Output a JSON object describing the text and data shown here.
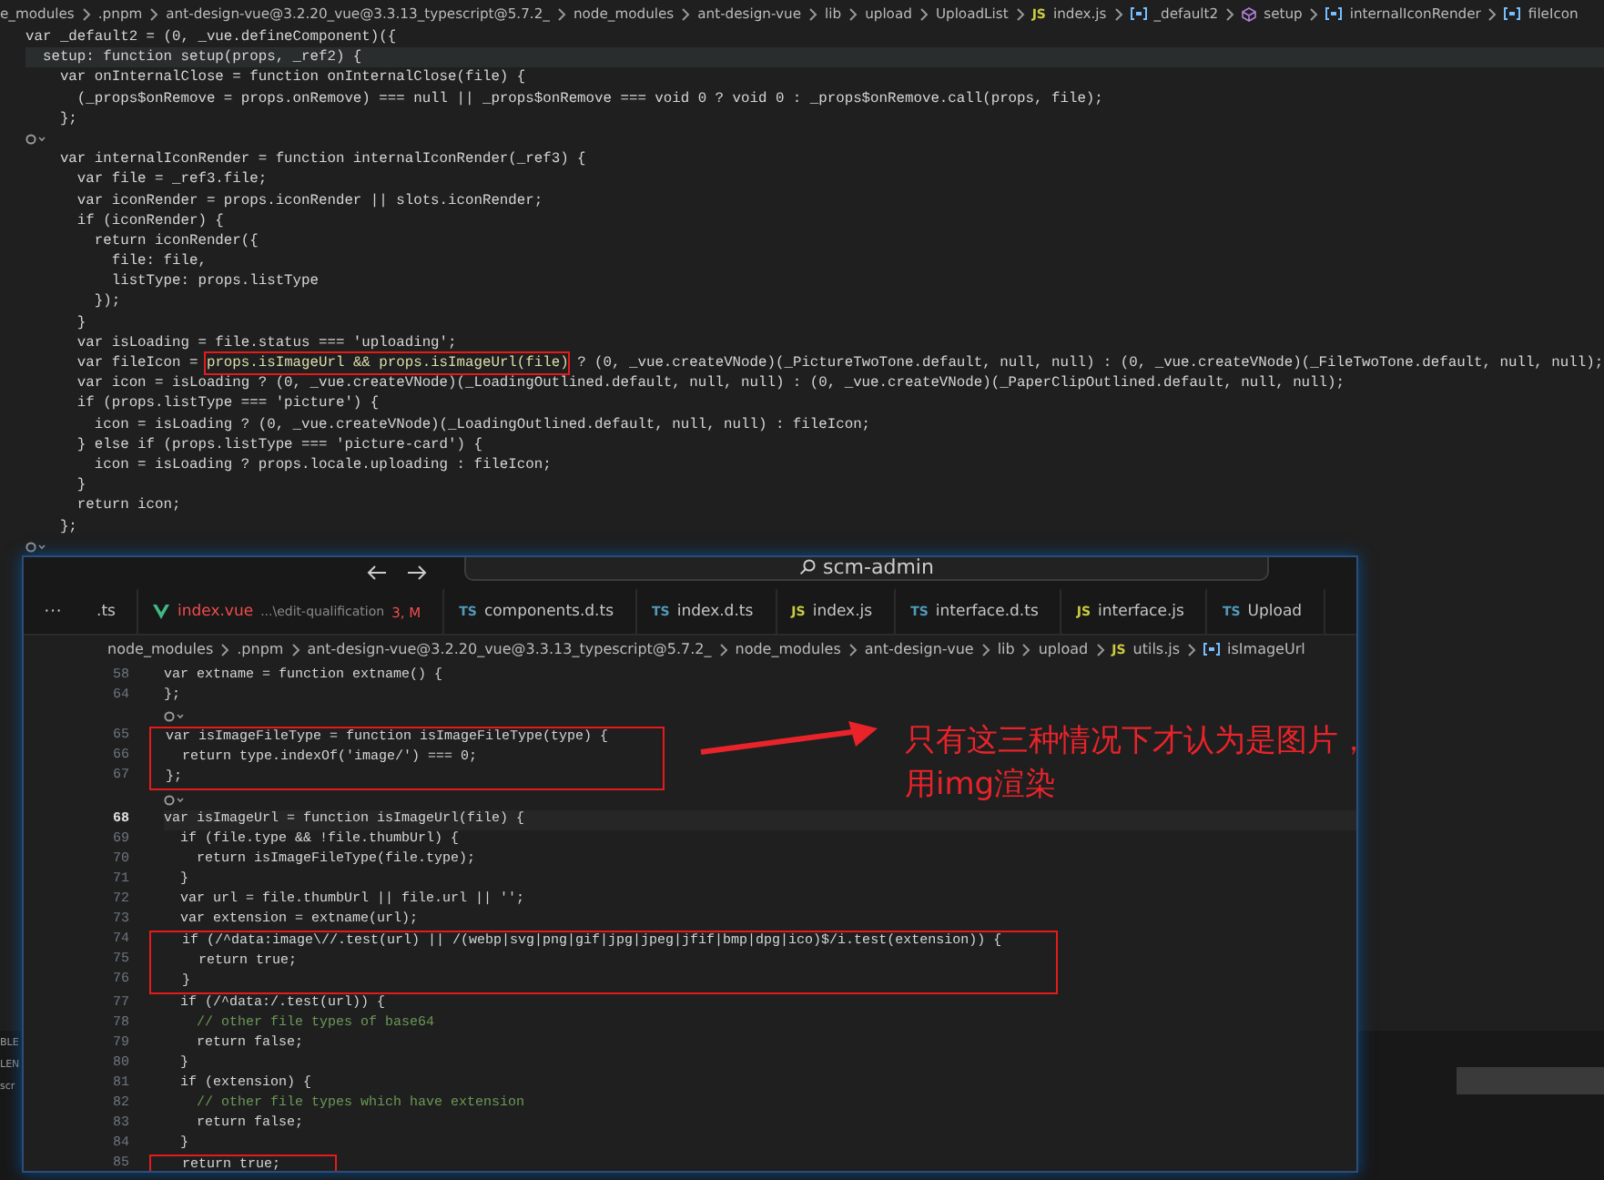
{
  "back_editor": {
    "breadcrumbs": [
      {
        "text": "e_modules",
        "kind": "folder"
      },
      {
        "text": ".pnpm",
        "kind": "folder"
      },
      {
        "text": "ant-design-vue@3.2.20_vue@3.3.13_typescript@5.7.2_",
        "kind": "folder"
      },
      {
        "text": "node_modules",
        "kind": "folder"
      },
      {
        "text": "ant-design-vue",
        "kind": "folder"
      },
      {
        "text": "lib",
        "kind": "folder"
      },
      {
        "text": "upload",
        "kind": "folder"
      },
      {
        "text": "UploadList",
        "kind": "folder"
      },
      {
        "text": "index.js",
        "kind": "js",
        "type_label": "JS"
      },
      {
        "text": "_default2",
        "kind": "variable"
      },
      {
        "text": "setup",
        "kind": "method"
      },
      {
        "text": "internalIconRender",
        "kind": "variable"
      },
      {
        "text": "fileIcon",
        "kind": "variable"
      }
    ],
    "lines": [
      {
        "kind": "code",
        "text": "var _default2 = (0, _vue.defineComponent)({",
        "current": false
      },
      {
        "kind": "code",
        "text": "  setup: function setup(props, _ref2) {",
        "current": true
      },
      {
        "kind": "code",
        "text": "    var onInternalClose = function onInternalClose(file) {",
        "current": false
      },
      {
        "kind": "code",
        "text": "      (_props$onRemove = props.onRemove) === null || _props$onRemove === void 0 ? void 0 : _props$onRemove.call(props, file);",
        "current": false
      },
      {
        "kind": "code",
        "text": "    };",
        "current": false
      },
      {
        "kind": "fold"
      },
      {
        "kind": "code",
        "text": "    var internalIconRender = function internalIconRender(_ref3) {",
        "current": false
      },
      {
        "kind": "code",
        "text": "      var file = _ref3.file;",
        "current": false
      },
      {
        "kind": "code",
        "text": "      var iconRender = props.iconRender || slots.iconRender;",
        "current": false
      },
      {
        "kind": "code",
        "text": "      if (iconRender) {",
        "current": false
      },
      {
        "kind": "code",
        "text": "        return iconRender({",
        "current": false
      },
      {
        "kind": "code",
        "text": "          file: file,",
        "current": false
      },
      {
        "kind": "code",
        "text": "          listType: props.listType",
        "current": false
      },
      {
        "kind": "code",
        "text": "        });",
        "current": false
      },
      {
        "kind": "code",
        "text": "      }",
        "current": false
      },
      {
        "kind": "code",
        "text": "      var isLoading = file.status === 'uploading';",
        "current": false
      },
      {
        "kind": "boxed",
        "text": "      var fileIcon = ",
        "boxed": "props.isImageUrl && props.isImageUrl(file)",
        "rest": " ? (0, _vue.createVNode)(_PictureTwoTone.default, null, null) : (0, _vue.createVNode)(_FileTwoTone.default, null, null);",
        "current": false
      },
      {
        "kind": "code",
        "text": "      var icon = isLoading ? (0, _vue.createVNode)(_LoadingOutlined.default, null, null) : (0, _vue.createVNode)(_PaperClipOutlined.default, null, null);",
        "current": false
      },
      {
        "kind": "code",
        "text": "      if (props.listType === 'picture') {",
        "current": false
      },
      {
        "kind": "code",
        "text": "        icon = isLoading ? (0, _vue.createVNode)(_LoadingOutlined.default, null, null) : fileIcon;",
        "current": false
      },
      {
        "kind": "code",
        "text": "      } else if (props.listType === 'picture-card') {",
        "current": false
      },
      {
        "kind": "code",
        "text": "        icon = isLoading ? props.locale.uploading : fileIcon;",
        "current": false
      },
      {
        "kind": "code",
        "text": "      }",
        "current": false
      },
      {
        "kind": "code",
        "text": "      return icon;",
        "current": false
      },
      {
        "kind": "code",
        "text": "    };",
        "current": false
      },
      {
        "kind": "fold"
      }
    ],
    "side_fragments": [
      "BLE",
      "LEN",
      "scr"
    ]
  },
  "front_window": {
    "search": {
      "value": "scm-admin"
    },
    "tabs": [
      {
        "kind": "plain",
        "label": ".ts",
        "selected": false,
        "has_errors": false
      },
      {
        "kind": "vue",
        "label": "index.vue",
        "detail": "...\\edit-qualification",
        "badge": "3, M",
        "selected": false,
        "has_errors": true
      },
      {
        "kind": "ts",
        "type_label": "TS",
        "label": "components.d.ts",
        "selected": false,
        "has_errors": false
      },
      {
        "kind": "ts",
        "type_label": "TS",
        "label": "index.d.ts",
        "selected": false,
        "has_errors": false
      },
      {
        "kind": "js",
        "type_label": "JS",
        "label": "index.js",
        "selected": false,
        "has_errors": false
      },
      {
        "kind": "ts",
        "type_label": "TS",
        "label": "interface.d.ts",
        "selected": false,
        "has_errors": false
      },
      {
        "kind": "js",
        "type_label": "JS",
        "label": "interface.js",
        "selected": false,
        "has_errors": false
      },
      {
        "kind": "ts",
        "type_label": "TS",
        "label": "Upload",
        "selected": false,
        "has_errors": false
      }
    ],
    "overflow_label": "···",
    "breadcrumbs": [
      {
        "text": "node_modules",
        "kind": "folder"
      },
      {
        "text": ".pnpm",
        "kind": "folder"
      },
      {
        "text": "ant-design-vue@3.2.20_vue@3.3.13_typescript@5.7.2_",
        "kind": "folder"
      },
      {
        "text": "node_modules",
        "kind": "folder"
      },
      {
        "text": "ant-design-vue",
        "kind": "folder"
      },
      {
        "text": "lib",
        "kind": "folder"
      },
      {
        "text": "upload",
        "kind": "folder"
      },
      {
        "text": "utils.js",
        "kind": "js",
        "type_label": "JS"
      },
      {
        "text": "isImageUrl",
        "kind": "variable"
      }
    ],
    "blocks": [
      {
        "framed": false,
        "lines": [
          {
            "kind": "code",
            "number": "58",
            "text": "var extname = function extname() {",
            "current": false
          },
          {
            "kind": "code",
            "number": "64",
            "text": "};",
            "current": false
          },
          {
            "kind": "fold"
          }
        ]
      },
      {
        "framed": true,
        "lines": [
          {
            "kind": "code",
            "number": "65",
            "text": "var isImageFileType = function isImageFileType(type) {",
            "current": false
          },
          {
            "kind": "code",
            "number": "66",
            "text": "  return type.indexOf('image/') === 0;",
            "current": false
          },
          {
            "kind": "code",
            "number": "67",
            "text": "};",
            "current": false
          }
        ]
      },
      {
        "framed": false,
        "lines": [
          {
            "kind": "fold"
          },
          {
            "kind": "code",
            "number": "68",
            "text": "var isImageUrl = function isImageUrl(file) {",
            "current": true
          },
          {
            "kind": "code",
            "number": "69",
            "text": "  if (file.type && !file.thumbUrl) {",
            "current": false
          },
          {
            "kind": "code",
            "number": "70",
            "text": "    return isImageFileType(file.type);",
            "current": false
          },
          {
            "kind": "code",
            "number": "71",
            "text": "  }",
            "current": false
          },
          {
            "kind": "code",
            "number": "72",
            "text": "  var url = file.thumbUrl || file.url || '';",
            "current": false
          },
          {
            "kind": "code",
            "number": "73",
            "text": "  var extension = extname(url);",
            "current": false
          }
        ]
      },
      {
        "framed": true,
        "lines": [
          {
            "kind": "code",
            "number": "74",
            "text": "  if (/^data:image\\//.test(url) || /(webp|svg|png|gif|jpg|jpeg|jfif|bmp|dpg|ico)$/i.test(extension)) {",
            "current": false
          },
          {
            "kind": "code",
            "number": "75",
            "text": "    return true;",
            "current": false
          },
          {
            "kind": "code",
            "number": "76",
            "text": "  }",
            "current": false
          }
        ]
      },
      {
        "framed": false,
        "lines": [
          {
            "kind": "code",
            "number": "77",
            "text": "  if (/^data:/.test(url)) {",
            "current": false
          },
          {
            "kind": "comment",
            "number": "78",
            "text": "    // other file types of base64",
            "current": false
          },
          {
            "kind": "code",
            "number": "79",
            "text": "    return false;",
            "current": false
          },
          {
            "kind": "code",
            "number": "80",
            "text": "  }",
            "current": false
          },
          {
            "kind": "code",
            "number": "81",
            "text": "  if (extension) {",
            "current": false
          },
          {
            "kind": "comment",
            "number": "82",
            "text": "    // other file types which have extension",
            "current": false
          },
          {
            "kind": "code",
            "number": "83",
            "text": "    return false;",
            "current": false
          },
          {
            "kind": "code",
            "number": "84",
            "text": "  }",
            "current": false
          }
        ]
      },
      {
        "framed": true,
        "lines": [
          {
            "kind": "code",
            "number": "85",
            "text": "  return true;",
            "current": false
          }
        ]
      }
    ]
  },
  "annotation": {
    "lines": [
      "只有这三种情况下才认为是图片，",
      "用img渲染"
    ]
  }
}
